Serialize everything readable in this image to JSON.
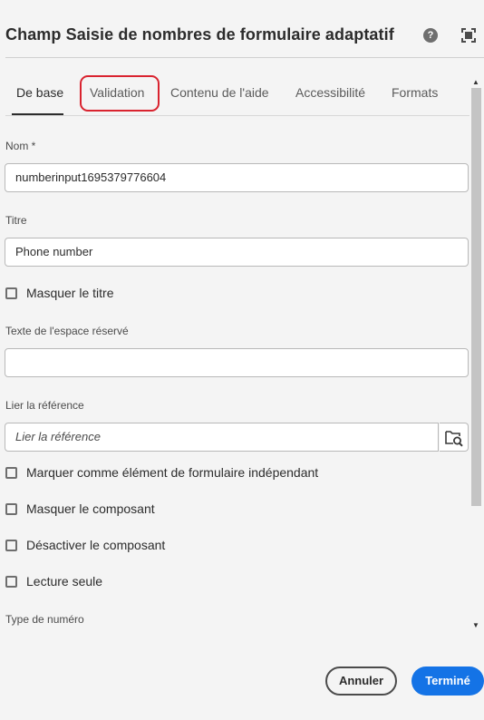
{
  "dialog": {
    "title": "Champ Saisie de nombres de formulaire adaptatif",
    "help_glyph": "?",
    "help_icon": "help-circle-icon",
    "fullscreen_icon": "fullscreen-icon"
  },
  "tabs": [
    {
      "label": "De base",
      "selected": true
    },
    {
      "label": "Validation",
      "selected": false,
      "highlighted": true
    },
    {
      "label": "Contenu de l'aide",
      "selected": false
    },
    {
      "label": "Accessibilité",
      "selected": false
    },
    {
      "label": "Formats",
      "selected": false
    }
  ],
  "form": {
    "name": {
      "label": "Nom *",
      "value": "numberinput1695379776604"
    },
    "title": {
      "label": "Titre",
      "value": "Phone number"
    },
    "hide_title": {
      "label": "Masquer le titre",
      "checked": false
    },
    "placeholder_text": {
      "label": "Texte de l'espace réservé",
      "value": ""
    },
    "bind_ref": {
      "label": "Lier la référence",
      "placeholder": "Lier la référence",
      "browse_icon": "folder-search-icon"
    },
    "independent_element": {
      "label": "Marquer comme élément de formulaire indépendant",
      "checked": false
    },
    "hide_component": {
      "label": "Masquer le composant",
      "checked": false
    },
    "disable_component": {
      "label": "Désactiver le composant",
      "checked": false
    },
    "read_only": {
      "label": "Lecture seule",
      "checked": false
    },
    "number_type": {
      "label": "Type de numéro"
    }
  },
  "footer": {
    "cancel_label": "Annuler",
    "done_label": "Terminé"
  },
  "colors": {
    "accent": "#1473e6",
    "highlight": "#d9232f",
    "background": "#f4f4f4"
  }
}
